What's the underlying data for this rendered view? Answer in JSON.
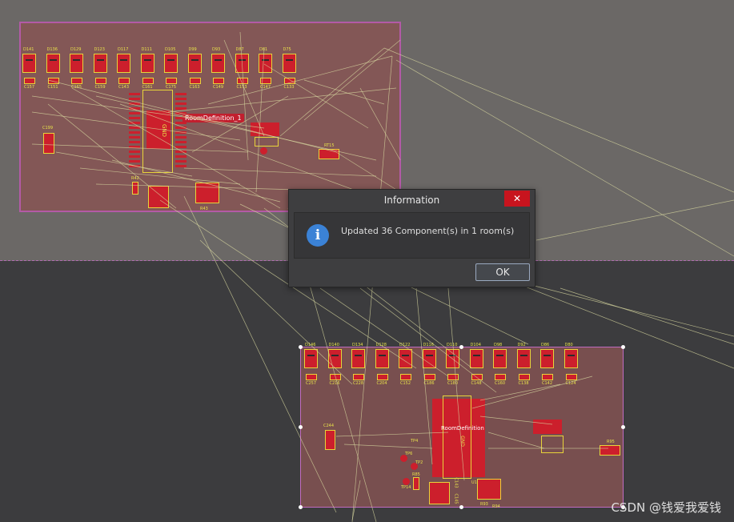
{
  "dialog": {
    "title": "Information",
    "close_glyph": "✕",
    "icon": "info-icon",
    "icon_glyph": "i",
    "message": "Updated 36 Component(s) in 1 room(s)",
    "ok_label": "OK"
  },
  "rooms": {
    "room1_label": "RoomDefinition_1",
    "room2_label": "RoomDefinition",
    "ic1_label": "GND",
    "ic2_label": "GND"
  },
  "room1": {
    "diodes": [
      "D141",
      "D136",
      "D129",
      "D123",
      "D117",
      "D111",
      "D105",
      "D99",
      "D93",
      "D87",
      "D81",
      "D75"
    ],
    "caps": [
      "C157",
      "C151",
      "C165",
      "C159",
      "C143",
      "C161",
      "C175",
      "C163",
      "C149",
      "C153",
      "C147",
      "C133"
    ],
    "extra": [
      "C199",
      "RT15",
      "R42",
      "R43",
      "C156",
      "C160"
    ]
  },
  "room2": {
    "diodes": [
      "D146",
      "D140",
      "D134",
      "D128",
      "D122",
      "D116",
      "D110",
      "D104",
      "D98",
      "D92",
      "D86",
      "D80"
    ],
    "caps": [
      "C257",
      "C216",
      "C228",
      "C204",
      "C152",
      "C186",
      "C180",
      "C148",
      "C160",
      "C138",
      "C142",
      "C124"
    ],
    "extra": [
      "C244",
      "R95",
      "TP4",
      "TP6",
      "TP2",
      "TP14",
      "R85",
      "U1",
      "R93",
      "R94",
      "C143",
      "C145"
    ]
  },
  "watermark": "CSDN @钱爱我爱钱",
  "colors": {
    "board_top": "#6b6866",
    "board_bottom": "#3c3c3e",
    "room_fill": "#8c5050",
    "room_border": "#b35aa6",
    "copper": "#cc1f2c",
    "silkscreen": "#e8d43a",
    "ratsnest": "#d8d8a0",
    "close_button": "#c8141e",
    "info_blue": "#3b82d6"
  }
}
